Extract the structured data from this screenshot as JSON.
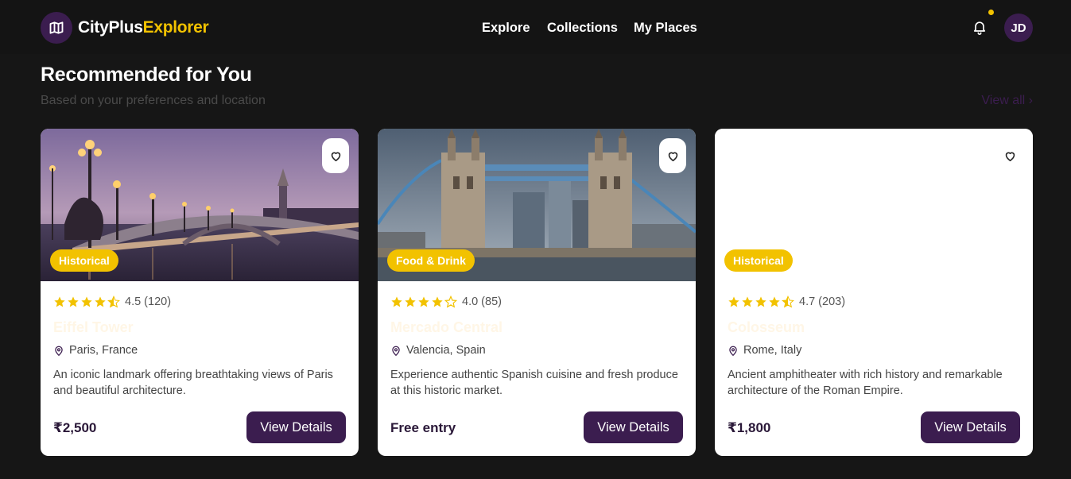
{
  "brand": {
    "part1": "CityPlus",
    "part2": "Explorer",
    "logo_icon": "map-icon"
  },
  "nav": {
    "explore": "Explore",
    "collections": "Collections",
    "my_places": "My Places"
  },
  "header": {
    "bell_icon": "bell-icon",
    "has_notification": true,
    "avatar_initials": "JD"
  },
  "section": {
    "title": "Recommended for You",
    "subtitle": "Based on your preferences and location",
    "view_all": "View all ›"
  },
  "colors": {
    "accent": "#f2c200",
    "primary": "#3b1d4f",
    "background": "#161616",
    "card": "#ffffff"
  },
  "cards": [
    {
      "tag": "Historical",
      "rating": "4.5",
      "reviews": "(120)",
      "stars": 4.5,
      "name": "Eiffel Tower",
      "location": "Paris, France",
      "description": "An iconic landmark offering breathtaking views of Paris and beautiful architecture.",
      "price": "₹2,500",
      "button": "View Details",
      "image": "bridge-night-photo"
    },
    {
      "tag": "Food & Drink",
      "rating": "4.0",
      "reviews": "(85)",
      "stars": 4,
      "name": "Mercado Central",
      "location": "Valencia, Spain",
      "description": "Experience authentic Spanish cuisine and fresh produce at this historic market.",
      "price": "Free entry",
      "button": "View Details",
      "image": "tower-bridge-photo"
    },
    {
      "tag": "Historical",
      "rating": "4.7",
      "reviews": "(203)",
      "stars": 4.5,
      "name": "Colosseum",
      "location": "Rome, Italy",
      "description": "Ancient amphitheater with rich history and remarkable architecture of the Roman Empire.",
      "price": "₹1,800",
      "button": "View Details",
      "image": "blank-image"
    }
  ]
}
